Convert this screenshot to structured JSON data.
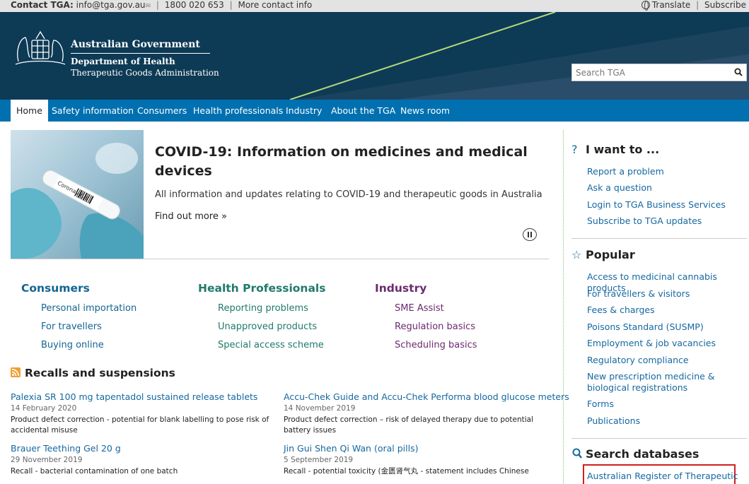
{
  "topbar": {
    "contact_label": "Contact TGA:",
    "email": "info@tga.gov.au",
    "phone": "1800 020 653",
    "more": "More contact info",
    "translate": "Translate",
    "subscribe": "Subscribe"
  },
  "header": {
    "gov": "Australian Government",
    "dept": "Department of Health",
    "agency": "Therapeutic Goods Administration",
    "search_placeholder": "Search TGA"
  },
  "nav": {
    "items": [
      "Home",
      "Safety information",
      "Consumers",
      "Health professionals",
      "Industry",
      "About the TGA",
      "News room"
    ]
  },
  "hero": {
    "title": "COVID-19: Information on medicines and medical devices",
    "desc": "All information and updates relating to COVID-19 and therapeutic goods in Australia",
    "more": "Find out more »",
    "image_label": "Coronavirus"
  },
  "columns": {
    "consumers": {
      "title": "Consumers",
      "links": [
        "Personal importation",
        "For travellers",
        "Buying online"
      ]
    },
    "health": {
      "title": "Health Professionals",
      "links": [
        "Reporting problems",
        "Unapproved products",
        "Special access scheme"
      ]
    },
    "industry": {
      "title": "Industry",
      "links": [
        "SME Assist",
        "Regulation basics",
        "Scheduling basics"
      ]
    }
  },
  "recalls": {
    "title": "Recalls and suspensions",
    "items": [
      {
        "title": "Palexia SR 100 mg tapentadol sustained release tablets",
        "date": "14 February 2020",
        "desc": "Product defect correction - potential for blank labelling to pose risk of accidental misuse"
      },
      {
        "title": "Accu-Chek Guide and Accu-Chek Performa blood glucose meters",
        "date": "14 November 2019",
        "desc": "Product defect correction – risk of delayed therapy due to potential battery issues"
      },
      {
        "title": "Brauer Teething Gel 20 g",
        "date": "29 November 2019",
        "desc": "Recall - bacterial contamination of one batch"
      },
      {
        "title": "Jin Gui Shen Qi Wan (oral pills)",
        "date": "5 September 2019",
        "desc": "Recall - potential toxicity (金匮肾气丸 - statement includes Chinese"
      }
    ]
  },
  "sidebar": {
    "iwant": {
      "title": "I want to ...",
      "links": [
        "Report a problem",
        "Ask a question",
        "Login to TGA Business Services",
        "Subscribe to TGA updates"
      ]
    },
    "popular": {
      "title": "Popular",
      "links": [
        "Access to medicinal cannabis products",
        "For travellers & visitors",
        "Fees & charges",
        "Poisons Standard (SUSMP)",
        "Employment & job vacancies",
        "Regulatory compliance",
        "New prescription medicine & biological registrations",
        "Forms",
        "Publications"
      ]
    },
    "databases": {
      "title": "Search databases",
      "links": [
        "Australian Register of Therapeutic"
      ]
    }
  }
}
